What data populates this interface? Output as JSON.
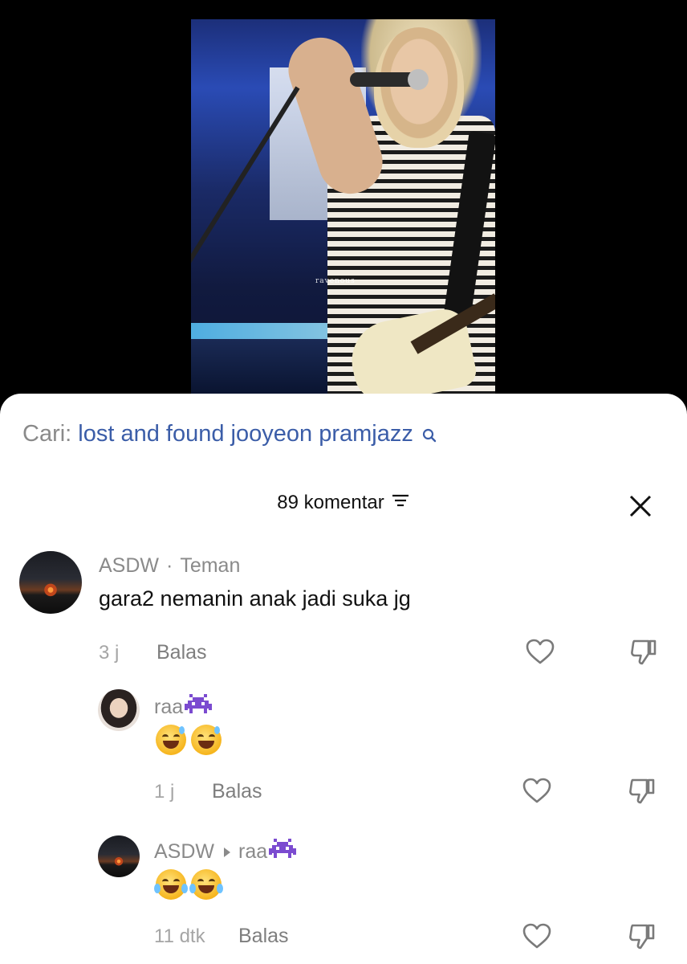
{
  "video": {
    "watermark": "ravenous"
  },
  "search": {
    "prefix": "Cari:",
    "query": "lost and found jooyeon pramjazz",
    "icon": "search-icon"
  },
  "header": {
    "count_label": "89 komentar",
    "sort_icon": "sort-icon",
    "close_icon": "close-icon"
  },
  "comments": [
    {
      "username": "ASDW",
      "tag": "Teman",
      "text": "gara2 nemanin anak jadi suka jg",
      "time": "3 j",
      "reply": "Balas",
      "avatar": "sunset-avatar"
    },
    {
      "username": "raa",
      "username_icon": "alien-monster-emoji",
      "emojis": [
        "grinning-sweat-emoji",
        "grinning-sweat-emoji"
      ],
      "time": "1 j",
      "reply": "Balas",
      "avatar": "girl-avatar"
    },
    {
      "username": "ASDW",
      "reply_to": "raa",
      "reply_to_icon": "alien-monster-emoji",
      "emojis": [
        "tears-of-joy-emoji",
        "tears-of-joy-emoji"
      ],
      "time": "11 dtk",
      "reply": "Balas",
      "avatar": "sunset-avatar"
    }
  ],
  "colors": {
    "search_query": "#3b5da8",
    "muted": "#8a8a8a",
    "text": "#111111"
  }
}
